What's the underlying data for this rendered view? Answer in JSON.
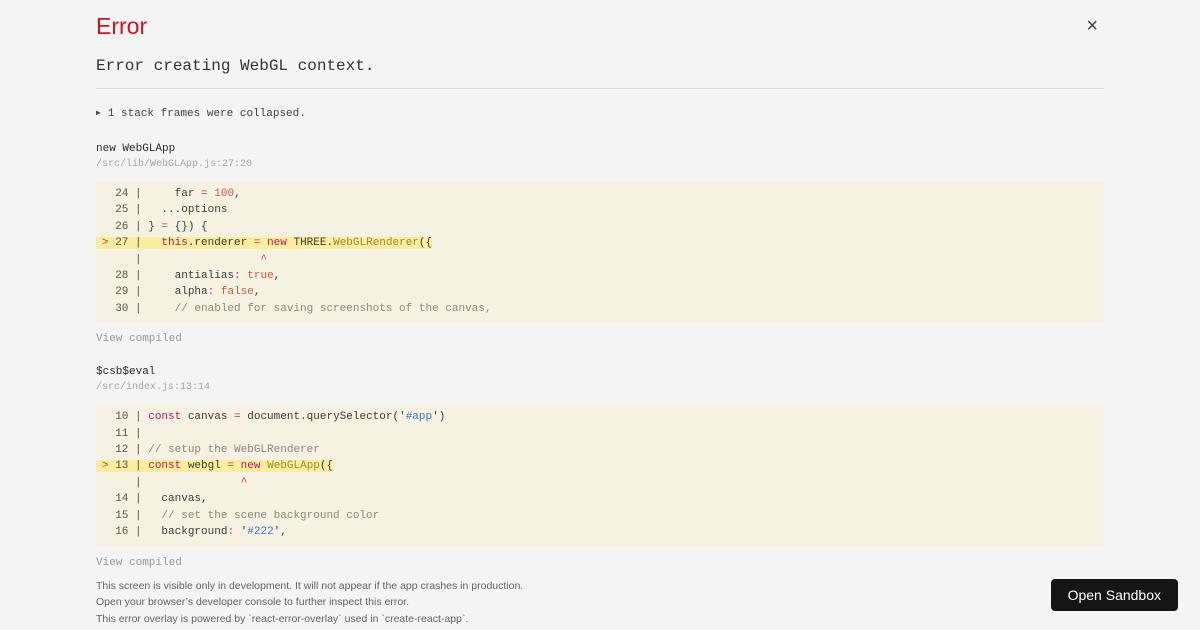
{
  "header": {
    "title": "Error",
    "close_label": "×",
    "message": "Error creating WebGL context."
  },
  "collapse": {
    "icon": "▶",
    "label": "1 stack frames were collapsed."
  },
  "frames": [
    {
      "function": "new WebGLApp",
      "location": "/src/lib/WebGLApp.js:27:20",
      "view_compiled_label": "View compiled",
      "lines": [
        {
          "hl": false,
          "tokens": [
            {
              "t": "  24 | ",
              "c": "ln"
            },
            {
              "t": "    far ",
              "c": "p"
            },
            {
              "t": "=",
              "c": "o"
            },
            {
              "t": " ",
              "c": "p"
            },
            {
              "t": "100",
              "c": "n"
            },
            {
              "t": ",",
              "c": "p"
            }
          ]
        },
        {
          "hl": false,
          "tokens": [
            {
              "t": "  25 | ",
              "c": "ln"
            },
            {
              "t": "  ...options",
              "c": "p"
            }
          ]
        },
        {
          "hl": false,
          "tokens": [
            {
              "t": "  26 | ",
              "c": "ln"
            },
            {
              "t": "} ",
              "c": "p"
            },
            {
              "t": "=",
              "c": "o"
            },
            {
              "t": " {}) {",
              "c": "p"
            }
          ]
        },
        {
          "hl": true,
          "tokens": [
            {
              "t": "> ",
              "c": "m"
            },
            {
              "t": "27 | ",
              "c": "ln"
            },
            {
              "t": "  ",
              "c": "p"
            },
            {
              "t": "this",
              "c": "k"
            },
            {
              "t": ".renderer ",
              "c": "p"
            },
            {
              "t": "=",
              "c": "o"
            },
            {
              "t": " ",
              "c": "p"
            },
            {
              "t": "new",
              "c": "k"
            },
            {
              "t": " THREE.",
              "c": "p"
            },
            {
              "t": "WebGLRenderer",
              "c": "f"
            },
            {
              "t": "({",
              "c": "p"
            }
          ]
        },
        {
          "hl": false,
          "tokens": [
            {
              "t": "     | ",
              "c": "ln"
            },
            {
              "t": "                 ",
              "c": "p"
            },
            {
              "t": "^",
              "c": "o"
            }
          ]
        },
        {
          "hl": false,
          "tokens": [
            {
              "t": "  28 | ",
              "c": "ln"
            },
            {
              "t": "    antialias",
              "c": "p"
            },
            {
              "t": ":",
              "c": "o"
            },
            {
              "t": " ",
              "c": "p"
            },
            {
              "t": "true",
              "c": "b"
            },
            {
              "t": ",",
              "c": "p"
            }
          ]
        },
        {
          "hl": false,
          "tokens": [
            {
              "t": "  29 | ",
              "c": "ln"
            },
            {
              "t": "    alpha",
              "c": "p"
            },
            {
              "t": ":",
              "c": "o"
            },
            {
              "t": " ",
              "c": "p"
            },
            {
              "t": "false",
              "c": "b"
            },
            {
              "t": ",",
              "c": "p"
            }
          ]
        },
        {
          "hl": false,
          "tokens": [
            {
              "t": "  30 | ",
              "c": "ln"
            },
            {
              "t": "    // enabled for saving screenshots of the canvas,",
              "c": "c"
            }
          ]
        }
      ]
    },
    {
      "function": "$csb$eval",
      "location": "/src/index.js:13:14",
      "view_compiled_label": "View compiled",
      "lines": [
        {
          "hl": false,
          "tokens": [
            {
              "t": "  10 | ",
              "c": "ln"
            },
            {
              "t": "const",
              "c": "k"
            },
            {
              "t": " canvas ",
              "c": "p"
            },
            {
              "t": "=",
              "c": "o"
            },
            {
              "t": " document.querySelector(",
              "c": "p"
            },
            {
              "t": "'",
              "c": "p"
            },
            {
              "t": "#app",
              "c": "s"
            },
            {
              "t": "'",
              "c": "p"
            },
            {
              "t": ")",
              "c": "p"
            }
          ]
        },
        {
          "hl": false,
          "tokens": [
            {
              "t": "  11 | ",
              "c": "ln"
            }
          ]
        },
        {
          "hl": false,
          "tokens": [
            {
              "t": "  12 | ",
              "c": "ln"
            },
            {
              "t": "// setup the WebGLRenderer",
              "c": "c"
            }
          ]
        },
        {
          "hl": true,
          "tokens": [
            {
              "t": "> ",
              "c": "m"
            },
            {
              "t": "13 | ",
              "c": "ln"
            },
            {
              "t": "const",
              "c": "k"
            },
            {
              "t": " webgl ",
              "c": "p"
            },
            {
              "t": "=",
              "c": "o"
            },
            {
              "t": " ",
              "c": "p"
            },
            {
              "t": "new",
              "c": "k"
            },
            {
              "t": " ",
              "c": "p"
            },
            {
              "t": "WebGLApp",
              "c": "f"
            },
            {
              "t": "({",
              "c": "p"
            }
          ]
        },
        {
          "hl": false,
          "tokens": [
            {
              "t": "     | ",
              "c": "ln"
            },
            {
              "t": "              ",
              "c": "p"
            },
            {
              "t": "^",
              "c": "o"
            }
          ]
        },
        {
          "hl": false,
          "tokens": [
            {
              "t": "  14 | ",
              "c": "ln"
            },
            {
              "t": "  canvas,",
              "c": "p"
            }
          ]
        },
        {
          "hl": false,
          "tokens": [
            {
              "t": "  15 | ",
              "c": "ln"
            },
            {
              "t": "  // set the scene background color",
              "c": "c"
            }
          ]
        },
        {
          "hl": false,
          "tokens": [
            {
              "t": "  16 | ",
              "c": "ln"
            },
            {
              "t": "  background",
              "c": "p"
            },
            {
              "t": ":",
              "c": "o"
            },
            {
              "t": " ",
              "c": "p"
            },
            {
              "t": "'",
              "c": "p"
            },
            {
              "t": "#222",
              "c": "s"
            },
            {
              "t": "'",
              "c": "p"
            },
            {
              "t": ",",
              "c": "p"
            }
          ]
        }
      ]
    }
  ],
  "footer": {
    "lines": [
      "This screen is visible only in development. It will not appear if the app crashes in production.",
      "Open your browser’s developer console to further inspect this error.",
      "This error overlay is powered by `react-error-overlay` used in `create-react-app`."
    ]
  },
  "sandbox_button": {
    "label": "Open Sandbox"
  },
  "colors": {
    "page_background": "#f4f4f4",
    "title_red": "#ce1126",
    "code_block_background": "#f5f2e3",
    "highlight_line_background": "#fbec9e",
    "sandbox_button_background": "#151515",
    "syntax": {
      "plain": "#3c3b36",
      "line_number": "#55534c",
      "marker": "#c5364a",
      "keyword": "#a71d5d",
      "operator": "#bf3a52",
      "number_boolean": "#cc5643",
      "class_name": "#9c8c26",
      "string": "#3b73c4",
      "comment": "#8a887d"
    }
  }
}
